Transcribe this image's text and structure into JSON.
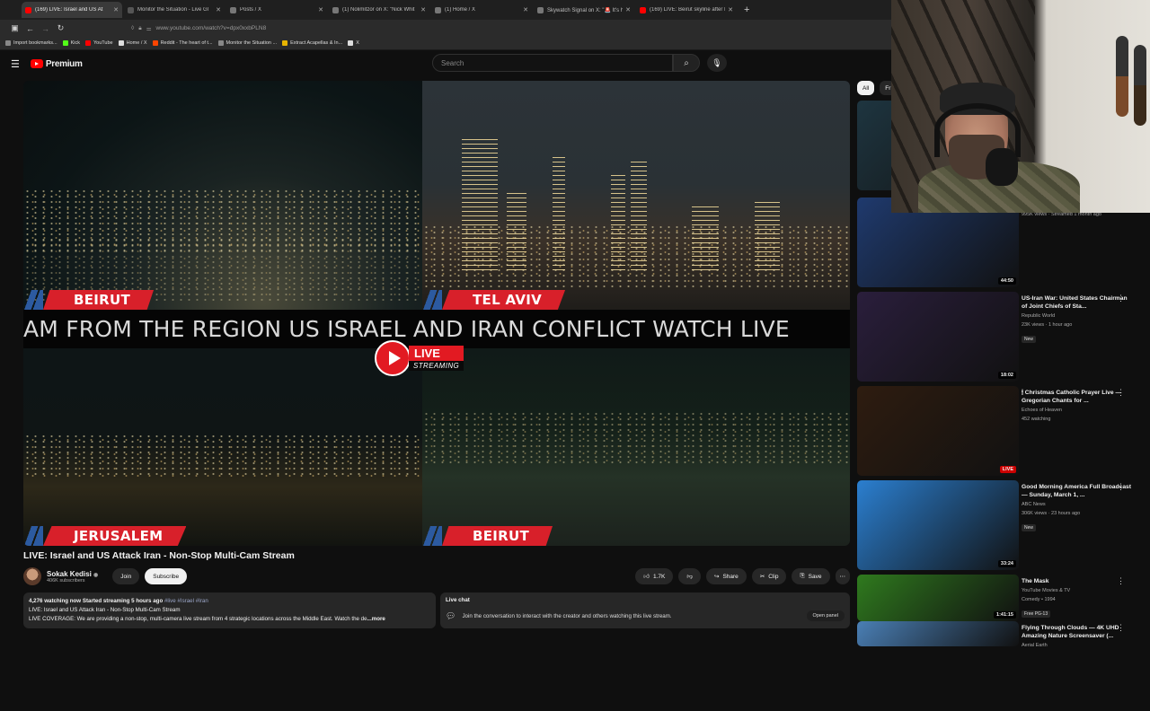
{
  "browser": {
    "tabs": [
      {
        "title": "(169) LIVE: Israel and US At",
        "color": "#ff0000",
        "active": true
      },
      {
        "title": "Monitor the Situation - Live Gl",
        "color": "#555555",
        "active": false
      },
      {
        "title": "Posts / X",
        "color": "#777777",
        "active": false
      },
      {
        "title": "(1) Nolimitzor on X: \"Nick Whit",
        "color": "#777777",
        "active": false
      },
      {
        "title": "(1) Home / X",
        "color": "#777777",
        "active": false
      },
      {
        "title": "Skywatch Signal on X: \"🚨 It's h",
        "color": "#777777",
        "active": false
      },
      {
        "title": "(169) LIVE: Beirut skyline after Is",
        "color": "#ff0000",
        "active": false
      }
    ],
    "url": "www.youtube.com/watch?v=dpx0xxbPLN8",
    "bookmarks": [
      {
        "label": "Import bookmarks...",
        "color": "#888888"
      },
      {
        "label": "Kick",
        "color": "#53fc18"
      },
      {
        "label": "YouTube",
        "color": "#ff0000"
      },
      {
        "label": "Home / X",
        "color": "#dddddd"
      },
      {
        "label": "Reddit - The heart of t...",
        "color": "#ff4500"
      },
      {
        "label": "Monitor the Situation ...",
        "color": "#888888"
      },
      {
        "label": "Extract Acapellas & In...",
        "color": "#e8b400"
      },
      {
        "label": "X",
        "color": "#dddddd"
      }
    ]
  },
  "yt": {
    "logo_text": "Premium",
    "search_placeholder": "Search"
  },
  "player": {
    "cities": [
      "BEIRUT",
      "TEL AVIV",
      "JERUSALEM",
      "BEIRUT"
    ],
    "ticker": "AM FROM THE REGION US ISRAEL AND IRAN CONFLICT WATCH LIVE",
    "live_label": "LIVE",
    "streaming_label": "STREAMING"
  },
  "video": {
    "title": "LIVE: Israel and US Attack Iran - Non-Stop Multi-Cam Stream",
    "channel": "Sokak Kedisi",
    "subscribers": "406K subscribers",
    "join": "Join",
    "subscribe": "Subscribe",
    "likes": "1.7K",
    "share": "Share",
    "clip": "Clip",
    "save": "Save",
    "desc_meta": "4,276 watching now  Started streaming 5 hours ago",
    "desc_tags": "#live #Israel #Iran",
    "desc_line2": "LIVE: Israel and US Attack Iran - Non-Stop Multi-Cam Stream",
    "desc_line3": "LIVE COVERAGE: We are providing a non-stop, multi-camera live stream from 4 strategic locations across the Middle East. Watch the de",
    "desc_more": "...more",
    "chat_title": "Live chat",
    "chat_text": "Join the conversation to interact with the creator and others watching this live stream.",
    "chat_open": "Open panel"
  },
  "chips": [
    "All",
    "Fr"
  ],
  "recommendations": [
    {
      "title": "",
      "channel": "",
      "meta": "",
      "badge": "",
      "tag": "LIVE",
      "bg": "#1e3540"
    },
    {
      "title": "",
      "channel": "Fox News",
      "meta": "995K views · Streamed 1 month ago",
      "badge": "",
      "tag": "44:50",
      "bg": "#1f3a6e"
    },
    {
      "title": "US-Iran War: United States Chairman of Joint Chiefs of Sta...",
      "channel": "Republic World",
      "meta": "23K views · 1 hour ago",
      "badge": "New",
      "tag": "18:02",
      "bg": "#2a1e3c"
    },
    {
      "title": "🕯 Christmas Catholic Prayer Live — Gregorian Chants for ...",
      "channel": "Echoes of Heaven",
      "meta": "452 watching",
      "badge": "",
      "tag": "LIVE",
      "bg": "#2e1c10"
    },
    {
      "title": "Good Morning America Full Broadcast — Sunday, March 1, ...",
      "channel": "ABC News",
      "meta": "306K views · 23 hours ago",
      "badge": "New",
      "tag": "33:24",
      "bg": "#2b7fd0"
    },
    {
      "title": "The Mask",
      "channel": "YouTube Movies & TV",
      "meta": "Comedy • 1994",
      "badge": "Free  PG-13",
      "tag": "1:41:15",
      "bg": "#2f7a1e"
    },
    {
      "title": "Flying Through Clouds — 4K UHD Amazing Nature Screensaver (...",
      "channel": "Aerial Earth",
      "meta": "",
      "badge": "",
      "tag": "",
      "bg": "#4a7fb5"
    }
  ]
}
